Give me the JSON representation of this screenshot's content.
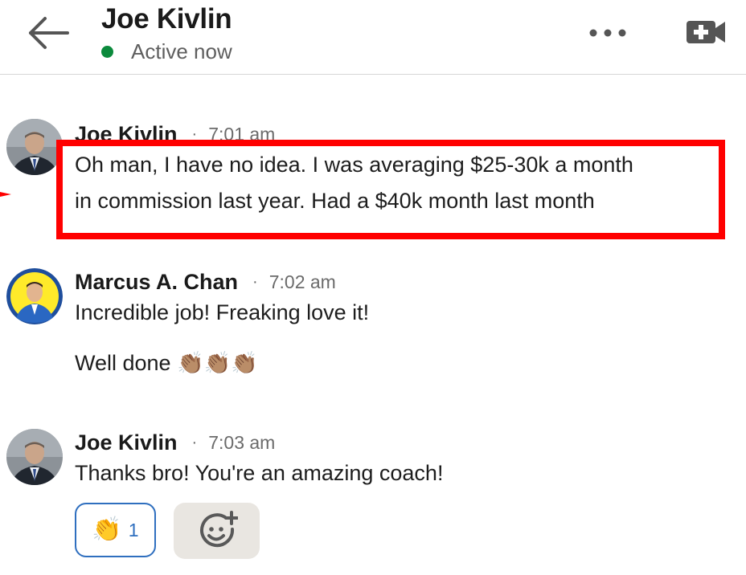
{
  "header": {
    "title": "Joe Kivlin",
    "status": "Active now",
    "status_color": "#0b8a3c",
    "icons": [
      "back-arrow-icon",
      "more-options-icon",
      "video-call-icon"
    ]
  },
  "messages": [
    {
      "sender": "Joe Kivlin",
      "separator": "·",
      "time": "7:01 am",
      "lines": [
        "Oh man, I have no idea. I was averaging $25-30k a month",
        "in commission last year. Had a $40k month last month"
      ],
      "highlight_color": "#ff0000"
    },
    {
      "sender": "Marcus A. Chan",
      "separator": "·",
      "time": "7:02 am",
      "lines": [
        "Incredible job! Freaking love it!"
      ],
      "second_text": "Well done",
      "emoji": "👏🏽👏🏽👏🏽"
    },
    {
      "sender": "Joe Kivlin",
      "separator": "·",
      "time": "7:03 am",
      "lines": [
        "Thanks bro! You're an amazing coach!"
      ],
      "reaction": {
        "emoji": "👏",
        "count": "1"
      },
      "add_reaction_icon": "add-emoji-icon"
    }
  ],
  "colors": {
    "accent_blue": "#2f6fbf",
    "highlight_red": "#ff0000",
    "add_reaction_bg": "#e9e6e1"
  }
}
